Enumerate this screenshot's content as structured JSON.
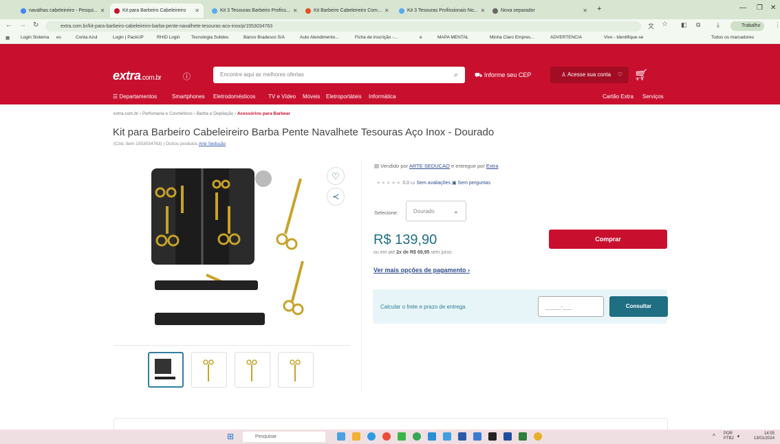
{
  "browser": {
    "tabs": [
      {
        "label": "navalhas cabeleireiro - Pesqui...",
        "color": "#4285f4"
      },
      {
        "label": "Kit para Barbeiro Cabeleireiro",
        "color": "#c8102e"
      },
      {
        "label": "Kit 3 Tesouras Barbeiro Profiss...",
        "color": "#55acee"
      },
      {
        "label": "Kit Barbeiro Cabeleireiro Com...",
        "color": "#e84e1b"
      },
      {
        "label": "Kit 3 Tesouras Profissionais No...",
        "color": "#55acee"
      },
      {
        "label": "Nova separador",
        "color": "#666666"
      }
    ],
    "url": "extra.com.br/kit-para-barbeiro-cabeleireiro-barba-pente-navalhete-tesouras-aco-inox/p/1553034763",
    "profile_label": "Trabalho",
    "bookmarks": [
      "Login Sistema",
      "es",
      "Conta Azul",
      "Login | PackUP",
      "RHID Login",
      "Tecnologia Solides",
      "Banco Bradesco S/A",
      "Auto Atendimento...",
      "Ficha de inscrição -...",
      "e",
      "MAPA MENTAL",
      "Minha Claro Empres...",
      "ADVERTENCIA",
      "Vivo - Identifique-se",
      "Todos os marcadores"
    ]
  },
  "header": {
    "logo_main": "extra",
    "logo_suffix": ".com.br",
    "search_placeholder": "Encontre aqui as melhores ofertas",
    "cep_label": "Informe seu CEP",
    "account_label": "Acesse sua conta",
    "nav_items": [
      "Departamentos",
      "Smartphones",
      "Eletrodomésticos",
      "TV e Vídeo",
      "Móveis",
      "Eletroportáteis",
      "Informática"
    ],
    "nav_right": [
      "Cartão Extra",
      "Serviços"
    ]
  },
  "breadcrumb": {
    "items": [
      "extra.com.br",
      "Perfumaria e Cosméticos",
      "Barba e Depilação"
    ],
    "current": "Acessórios para Barbear",
    "sep": "›"
  },
  "product": {
    "title": "Kit para Barbeiro Cabeleireiro Barba Pente Navalhete Tesouras Aço Inox - Dourado",
    "code_text": "(Cód. Item 1553034763)",
    "other_products_label": "Outros produtos",
    "brand": "Arte Sedução",
    "seller_prefix": "Vendido por",
    "seller": "ARTE SEDUCAO",
    "delivered_prefix": "e entregue por",
    "delivered_by": "Extra",
    "rating_value": "0.0",
    "reviews_label": "Sem avaliações",
    "questions_label": "Sem perguntas",
    "select_label": "Selecione:",
    "selected_option": "Dourado",
    "price": "R$ 139,90",
    "installment_prefix": "ou em até",
    "installment_bold": "2x de R$ 69,95",
    "installment_suffix": "sem juros",
    "more_options": "Ver mais opções de pagamento",
    "buy_label": "Comprar",
    "shipping_label": "Calcular o frete e prazo de entrega",
    "cep_placeholder": "_____-___",
    "consult_label": "Consultar"
  },
  "taskbar": {
    "search_placeholder": "Pesquisar",
    "lang_top": "POR",
    "lang_bottom": "PTB2",
    "time": "14:55",
    "date": "13/01/2024"
  },
  "colors": {
    "brand_red": "#c8102e",
    "teal": "#1f6e82"
  }
}
